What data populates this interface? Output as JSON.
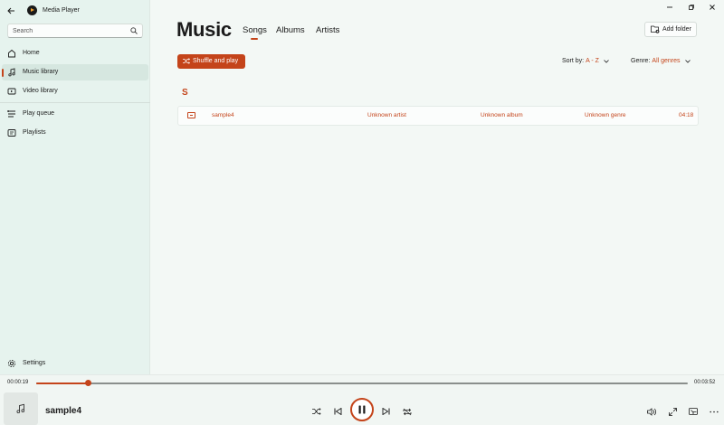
{
  "app": {
    "title": "Media Player"
  },
  "search": {
    "placeholder": "Search"
  },
  "sidebar": {
    "items": [
      {
        "label": "Home",
        "icon": "home-icon"
      },
      {
        "label": "Music library",
        "icon": "music-note-icon",
        "active": true
      },
      {
        "label": "Video library",
        "icon": "video-icon"
      },
      {
        "label": "Play queue",
        "icon": "queue-icon"
      },
      {
        "label": "Playlists",
        "icon": "playlist-icon"
      }
    ],
    "settings_label": "Settings"
  },
  "main": {
    "title": "Music",
    "tabs": [
      {
        "label": "Songs",
        "active": true
      },
      {
        "label": "Albums"
      },
      {
        "label": "Artists"
      }
    ],
    "add_folder_label": "Add folder",
    "shuffle_label": "Shuffle and play",
    "sort": {
      "label": "Sort by:",
      "value": "A - Z"
    },
    "genre": {
      "label": "Genre:",
      "value": "All genres"
    },
    "group_letter": "S",
    "songs": [
      {
        "title": "sample4",
        "artist": "Unknown artist",
        "album": "Unknown album",
        "genre": "Unknown genre",
        "duration": "04:18"
      }
    ]
  },
  "player": {
    "elapsed": "00:00:19",
    "remaining": "00:03:52",
    "progress": 0.08,
    "now_playing": "sample4"
  },
  "colors": {
    "accent": "#c4441a",
    "sidebar_bg": "#e6f3ee",
    "page_bg": "#f3f8f5"
  }
}
